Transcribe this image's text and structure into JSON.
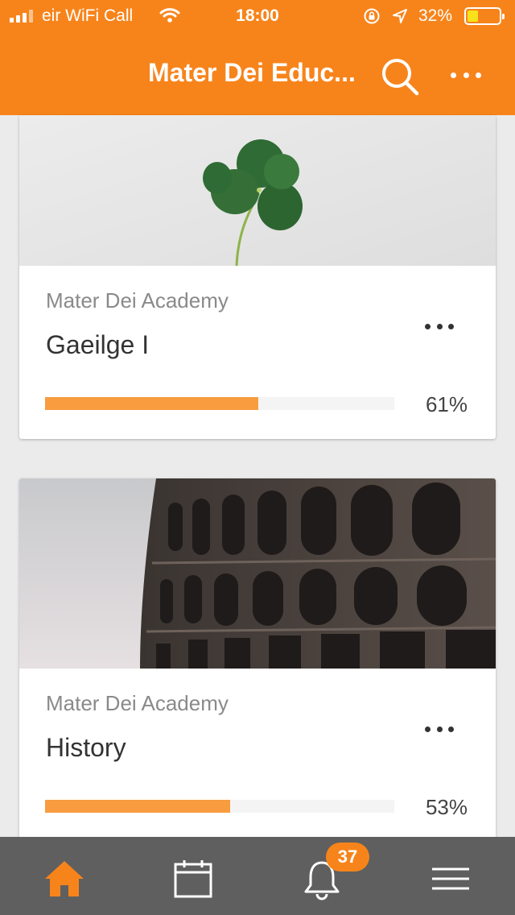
{
  "status_bar": {
    "carrier": "eir WiFi Call",
    "time": "18:00",
    "battery_percent": "32%",
    "battery_level": 0.32
  },
  "header": {
    "title": "Mater Dei Educ...",
    "search_icon": "search-icon",
    "more_icon": "more-horizontal-icon",
    "color": "#f7841b"
  },
  "courses": [
    {
      "school": "Mater Dei Academy",
      "name": "Gaeilge I",
      "progress": 0.61,
      "progress_label": "61%",
      "image": "shamrock-on-paper"
    },
    {
      "school": "Mater Dei Academy",
      "name": "History",
      "progress": 0.53,
      "progress_label": "53%",
      "image": "colosseum"
    }
  ],
  "tabbar": {
    "items": [
      {
        "icon": "home-icon",
        "active": true
      },
      {
        "icon": "calendar-icon",
        "active": false
      },
      {
        "icon": "bell-icon",
        "active": false,
        "badge": "37"
      },
      {
        "icon": "menu-icon",
        "active": false
      }
    ],
    "active_color": "#f7841b"
  }
}
